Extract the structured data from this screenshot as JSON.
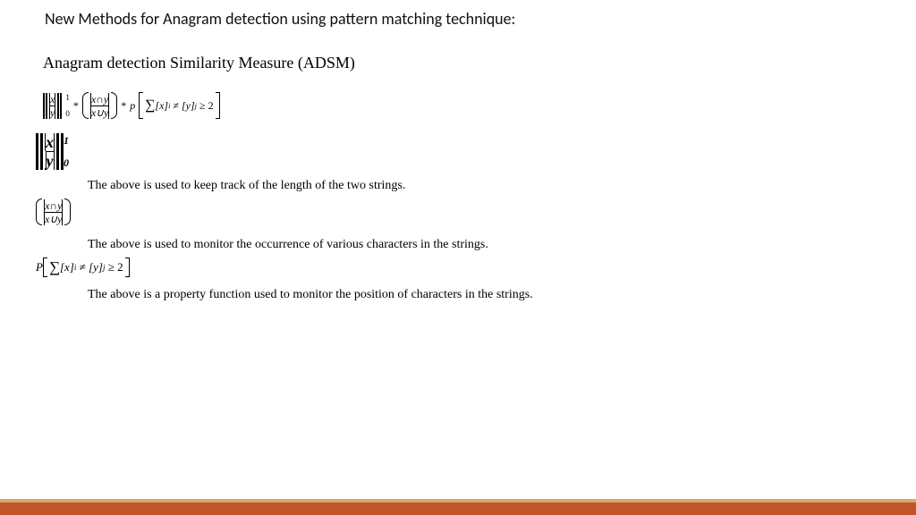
{
  "title": "New Methods for Anagram detection using pattern matching technique:",
  "subtitle": "Anagram detection Similarity Measure (ADSM)",
  "vars": {
    "x": "x",
    "y": "y",
    "cap": "∩",
    "cup": "∪",
    "p": "p",
    "P": "P"
  },
  "formula": {
    "sup1": "1",
    "sub0": "0",
    "star": "*",
    "sum_body": "[x]",
    "sum_body2": "[y]",
    "neq": "≠",
    "geq2": "≥ 2",
    "i": "i",
    "j": "j"
  },
  "explain1": "The above is used to keep track of the length of the two strings.",
  "explain2": "The above is used to monitor the occurrence of various characters in the strings.",
  "explain3": "The above is a property function used to monitor the position of characters in the strings."
}
